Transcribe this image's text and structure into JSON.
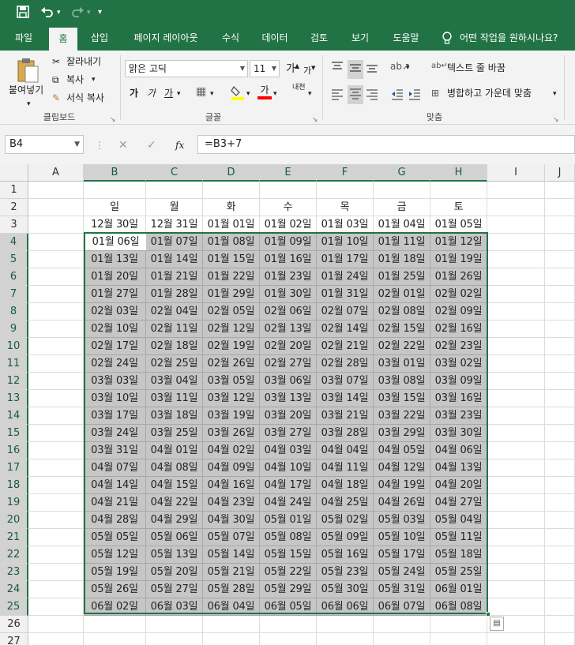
{
  "title_bar": {
    "save_icon": "save-icon",
    "undo_icon": "undo-icon",
    "redo_icon": "redo-icon",
    "customize_icon": "customize-quick-access-icon"
  },
  "tabs": [
    {
      "label": "파일"
    },
    {
      "label": "홈"
    },
    {
      "label": "삽입"
    },
    {
      "label": "페이지 레이아웃"
    },
    {
      "label": "수식"
    },
    {
      "label": "데이터"
    },
    {
      "label": "검토"
    },
    {
      "label": "보기"
    },
    {
      "label": "도움말"
    }
  ],
  "tell_me": "어떤 작업을 원하시나요?",
  "ribbon": {
    "clipboard": {
      "paste": "붙여넣기",
      "cut": "잘라내기",
      "copy": "복사",
      "format_painter": "서식 복사",
      "group_label": "클립보드"
    },
    "font": {
      "font_name": "맑은 고딕",
      "font_size": "11",
      "grow": "가",
      "shrink": "가",
      "bold": "가",
      "italic": "가",
      "underline": "가",
      "font_color_glyph": "가",
      "phonetic": "내천",
      "group_label": "글꼴",
      "fill_color": "#ffff00",
      "font_color": "#ff0000"
    },
    "alignment": {
      "wrap_text": "텍스트 줄 바꿈",
      "merge_center": "병합하고 가운데 맞춤",
      "group_label": "맞춤"
    }
  },
  "formula_bar": {
    "name_box": "B4",
    "formula": "=B3+7",
    "cancel": "✕",
    "enter": "✓",
    "fx": "fx"
  },
  "columns": [
    "A",
    "B",
    "C",
    "D",
    "E",
    "F",
    "G",
    "H",
    "I",
    "J"
  ],
  "rows": [
    "1",
    "2",
    "3",
    "4",
    "5",
    "6",
    "7",
    "8",
    "9",
    "10",
    "11",
    "12",
    "13",
    "14",
    "15",
    "16",
    "17",
    "18",
    "19",
    "20",
    "21",
    "22",
    "23",
    "24",
    "25",
    "26",
    "27"
  ],
  "sheet": {
    "weekday_headers": [
      "일",
      "월",
      "화",
      "수",
      "목",
      "금",
      "토"
    ],
    "start_dates": [
      "12월 30일",
      "12월 31일",
      "01월 01일",
      "01월 02일",
      "01월 03일",
      "01월 04일",
      "01월 05일"
    ],
    "date_rows": [
      [
        "01월 06일",
        "01월 07일",
        "01월 08일",
        "01월 09일",
        "01월 10일",
        "01월 11일",
        "01월 12일"
      ],
      [
        "01월 13일",
        "01월 14일",
        "01월 15일",
        "01월 16일",
        "01월 17일",
        "01월 18일",
        "01월 19일"
      ],
      [
        "01월 20일",
        "01월 21일",
        "01월 22일",
        "01월 23일",
        "01월 24일",
        "01월 25일",
        "01월 26일"
      ],
      [
        "01월 27일",
        "01월 28일",
        "01월 29일",
        "01월 30일",
        "01월 31일",
        "02월 01일",
        "02월 02일"
      ],
      [
        "02월 03일",
        "02월 04일",
        "02월 05일",
        "02월 06일",
        "02월 07일",
        "02월 08일",
        "02월 09일"
      ],
      [
        "02월 10일",
        "02월 11일",
        "02월 12일",
        "02월 13일",
        "02월 14일",
        "02월 15일",
        "02월 16일"
      ],
      [
        "02월 17일",
        "02월 18일",
        "02월 19일",
        "02월 20일",
        "02월 21일",
        "02월 22일",
        "02월 23일"
      ],
      [
        "02월 24일",
        "02월 25일",
        "02월 26일",
        "02월 27일",
        "02월 28일",
        "03월 01일",
        "03월 02일"
      ],
      [
        "03월 03일",
        "03월 04일",
        "03월 05일",
        "03월 06일",
        "03월 07일",
        "03월 08일",
        "03월 09일"
      ],
      [
        "03월 10일",
        "03월 11일",
        "03월 12일",
        "03월 13일",
        "03월 14일",
        "03월 15일",
        "03월 16일"
      ],
      [
        "03월 17일",
        "03월 18일",
        "03월 19일",
        "03월 20일",
        "03월 21일",
        "03월 22일",
        "03월 23일"
      ],
      [
        "03월 24일",
        "03월 25일",
        "03월 26일",
        "03월 27일",
        "03월 28일",
        "03월 29일",
        "03월 30일"
      ],
      [
        "03월 31일",
        "04월 01일",
        "04월 02일",
        "04월 03일",
        "04월 04일",
        "04월 05일",
        "04월 06일"
      ],
      [
        "04월 07일",
        "04월 08일",
        "04월 09일",
        "04월 10일",
        "04월 11일",
        "04월 12일",
        "04월 13일"
      ],
      [
        "04월 14일",
        "04월 15일",
        "04월 16일",
        "04월 17일",
        "04월 18일",
        "04월 19일",
        "04월 20일"
      ],
      [
        "04월 21일",
        "04월 22일",
        "04월 23일",
        "04월 24일",
        "04월 25일",
        "04월 26일",
        "04월 27일"
      ],
      [
        "04월 28일",
        "04월 29일",
        "04월 30일",
        "05월 01일",
        "05월 02일",
        "05월 03일",
        "05월 04일"
      ],
      [
        "05월 05일",
        "05월 06일",
        "05월 07일",
        "05월 08일",
        "05월 09일",
        "05월 10일",
        "05월 11일"
      ],
      [
        "05월 12일",
        "05월 13일",
        "05월 14일",
        "05월 15일",
        "05월 16일",
        "05월 17일",
        "05월 18일"
      ],
      [
        "05월 19일",
        "05월 20일",
        "05월 21일",
        "05월 22일",
        "05월 23일",
        "05월 24일",
        "05월 25일"
      ],
      [
        "05월 26일",
        "05월 27일",
        "05월 28일",
        "05월 29일",
        "05월 30일",
        "05월 31일",
        "06월 01일"
      ],
      [
        "06월 02일",
        "06월 03일",
        "06월 04일",
        "06월 05일",
        "06월 06일",
        "06월 07일",
        "06월 08일"
      ]
    ]
  },
  "quick_analysis_icon": "quick-analysis-icon",
  "colors": {
    "accent": "#217346",
    "selection_fill": "#c6c6c6"
  }
}
